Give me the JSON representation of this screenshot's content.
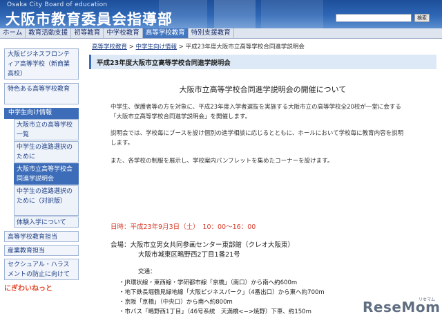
{
  "header": {
    "english_title": "Osaka City Board of education",
    "title": "大阪市教育委員会指導部",
    "search_button": "検索",
    "search_placeholder": ""
  },
  "nav": {
    "tabs": [
      "ホーム",
      "教育活動支援",
      "初等教育",
      "中学校教育",
      "高等学校教育",
      "特別支援教育"
    ]
  },
  "sidebar": {
    "items": [
      "大阪ビジネスフロンティア高等学校（新商業高校）",
      "特色ある高等学校教育",
      "中学生向け情報",
      "大阪市立の高等学校一覧",
      "中学生の進路選択のために",
      "大阪市立高等学校合同進学説明会",
      "中学生の進路選択のために（対訳版）",
      "体験入学について",
      "高等学校教育担当",
      "産業教育担当",
      "セクシュアル・ハラスメントの防止に向けて"
    ],
    "banner": "にぎわいねっと"
  },
  "breadcrumb": {
    "items": [
      "高等学校教育",
      "中学生向け情報",
      "平成23年度大阪市立高等学校合同進学説明会"
    ],
    "separator": ">"
  },
  "page": {
    "title_band": "平成23年度大阪市立高等学校合同進学説明会",
    "heading": "大阪市立高等学校合同進学説明会の開催について",
    "para1_line1": "中学生、保護者等の方を対象に、平成23年度入学者選抜を実施する大阪市立の高等学校全20校が一堂に会する",
    "para1_line2": "「大阪市立高等学校合同進学説明会」を開催します。",
    "para2_line1": "説明会では、学校毎にブースを設け個別の進学相談に応じるとともに、ホールにおいて学校毎に教育内容を説明",
    "para2_line2": "します。",
    "para3": "また、各学校の制服を展示し、学校案内パンフレットを集めたコーナーを設けます。",
    "date": "日時：平成23年9月3日（土）　10：00〜16：00",
    "venue": "会場：大阪市立男女共同参画センター東部館（クレオ大阪東）",
    "address": "大阪市城東区鴫野西2丁目1番21号",
    "access_title": "交通：",
    "access": [
      "・JR環状線・東西線・学研都市線「京橋」（南口）から南へ約600m",
      "・地下鉄長堀鶴見緑地線「大阪ビジネスパーク」（4番出口）から東へ約700m",
      "・京阪「京橋」（中央口）から南へ約800m",
      "・市バス「鴫野西1丁目」（46号系統　天満橋<−>焼野）下車、約150m"
    ]
  },
  "watermark": {
    "brand": "ReseMom",
    "small": "リセマム"
  }
}
